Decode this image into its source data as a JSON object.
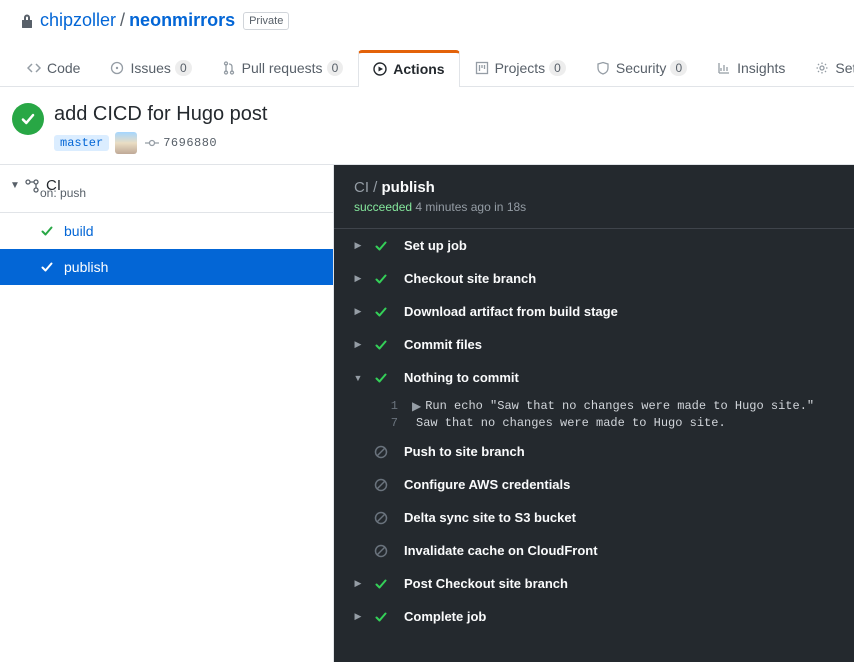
{
  "breadcrumb": {
    "owner": "chipzoller",
    "repo": "neonmirrors",
    "private_label": "Private"
  },
  "tabs": {
    "code": "Code",
    "issues": "Issues",
    "issues_count": "0",
    "pulls": "Pull requests",
    "pulls_count": "0",
    "actions": "Actions",
    "projects": "Projects",
    "projects_count": "0",
    "security": "Security",
    "security_count": "0",
    "insights": "Insights",
    "settings": "Settings"
  },
  "run": {
    "title": "add CICD for Hugo post",
    "branch": "master",
    "sha": "7696880"
  },
  "workflow": {
    "name": "CI",
    "trigger_label": "on: push",
    "jobs": [
      {
        "name": "build"
      },
      {
        "name": "publish"
      }
    ]
  },
  "detail": {
    "workflow_name": "CI",
    "job_name": "publish",
    "status": "succeeded",
    "when": "4 minutes ago",
    "duration": "18s",
    "steps": [
      {
        "kind": "ok",
        "name": "Set up job"
      },
      {
        "kind": "ok",
        "name": "Checkout site branch"
      },
      {
        "kind": "ok",
        "name": "Download artifact from build stage"
      },
      {
        "kind": "ok",
        "name": "Commit files"
      },
      {
        "kind": "ok-open",
        "name": "Nothing to commit"
      },
      {
        "kind": "skip",
        "name": "Push to site branch"
      },
      {
        "kind": "skip",
        "name": "Configure AWS credentials"
      },
      {
        "kind": "skip",
        "name": "Delta sync site to S3 bucket"
      },
      {
        "kind": "skip",
        "name": "Invalidate cache on CloudFront"
      },
      {
        "kind": "ok",
        "name": "Post Checkout site branch"
      },
      {
        "kind": "ok",
        "name": "Complete job"
      }
    ],
    "log": {
      "l1_num": "1",
      "l1_txt": "Run echo \"Saw that no changes were made to Hugo site.\"",
      "l2_num": "7",
      "l2_txt": "Saw that no changes were made to Hugo site."
    }
  }
}
